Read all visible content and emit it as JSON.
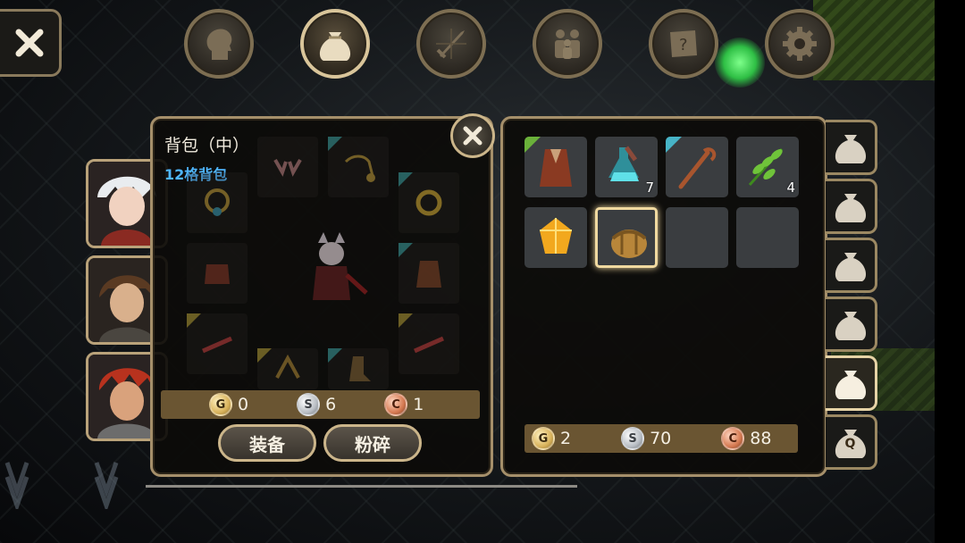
{
  "nav": {
    "items": [
      {
        "icon": "head-icon",
        "active": false
      },
      {
        "icon": "bag-icon",
        "active": true
      },
      {
        "icon": "sword-icon",
        "active": false
      },
      {
        "icon": "party-icon",
        "active": false
      },
      {
        "icon": "quest-scroll-icon",
        "active": false
      },
      {
        "icon": "gear-icon",
        "active": false
      }
    ]
  },
  "equipment_panel": {
    "title": "背包（中）",
    "subtitle": "12格背包",
    "money": {
      "gold": "0",
      "silver": "6",
      "copper": "1"
    },
    "equip_button": "装备",
    "smash_button": "粉碎"
  },
  "inventory": {
    "slots": [
      {
        "item": "robe-armor-icon",
        "count": "",
        "corner": "green"
      },
      {
        "item": "teal-potion-icon",
        "count": "7",
        "corner": ""
      },
      {
        "item": "wooden-staff-icon",
        "count": "",
        "corner": "teal"
      },
      {
        "item": "green-herb-icon",
        "count": "4",
        "corner": ""
      },
      {
        "item": "amber-gem-icon",
        "count": "",
        "corner": ""
      },
      {
        "item": "leather-bag-icon",
        "count": "",
        "corner": "",
        "selected": true
      },
      {
        "item": "",
        "count": "",
        "corner": ""
      },
      {
        "item": "",
        "count": "",
        "corner": ""
      }
    ],
    "money": {
      "gold": "2",
      "silver": "70",
      "copper": "88"
    }
  },
  "coin_letters": {
    "gold": "G",
    "silver": "S",
    "copper": "C"
  },
  "side_tabs": [
    {
      "icon": "bag-tab-icon",
      "active": false
    },
    {
      "icon": "bag-tab-icon",
      "active": false
    },
    {
      "icon": "bag-tab-icon",
      "active": false
    },
    {
      "icon": "bag-tab-icon",
      "active": false
    },
    {
      "icon": "bag-tab-icon",
      "active": true
    },
    {
      "icon": "quest-bag-tab-icon",
      "label": "Q",
      "active": false
    }
  ],
  "colors": {
    "frame": "#a58f6a",
    "accent_blue": "#4fb6ff",
    "money_bar": "#6a5532"
  }
}
